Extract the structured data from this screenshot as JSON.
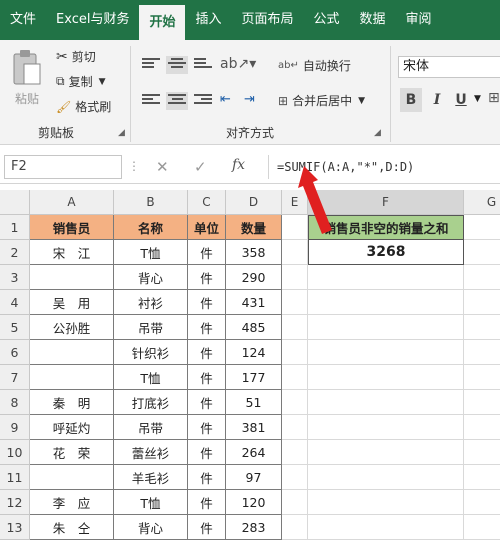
{
  "tabs": [
    "文件",
    "Excel与财务",
    "开始",
    "插入",
    "页面布局",
    "公式",
    "数据",
    "审阅"
  ],
  "ribbon": {
    "paste": "粘贴",
    "cut": "剪切",
    "copy": "复制",
    "format_painter": "格式刷",
    "clipboard_group": "剪贴板",
    "wrap_text": "自动换行",
    "merge_center": "合并后居中",
    "alignment_group": "对齐方式",
    "font_name": "宋体",
    "bold": "B",
    "italic": "I",
    "underline": "U"
  },
  "formula_bar": {
    "name_box": "F2",
    "formula": "=SUMIF(A:A,\"*\",D:D)",
    "cancel": "✕",
    "enter": "✓",
    "fx": "fx"
  },
  "columns": [
    "A",
    "B",
    "C",
    "D",
    "E",
    "F",
    "G"
  ],
  "row_numbers": [
    "1",
    "2",
    "3",
    "4",
    "5",
    "6",
    "7",
    "8",
    "9",
    "10",
    "11",
    "12",
    "13"
  ],
  "table": {
    "headers": [
      "销售员",
      "名称",
      "单位",
      "数量"
    ],
    "rows": [
      [
        "宋　江",
        "T恤",
        "件",
        "358"
      ],
      [
        "",
        "背心",
        "件",
        "290"
      ],
      [
        "吴　用",
        "衬衫",
        "件",
        "431"
      ],
      [
        "公孙胜",
        "吊带",
        "件",
        "485"
      ],
      [
        "",
        "针织衫",
        "件",
        "124"
      ],
      [
        "",
        "T恤",
        "件",
        "177"
      ],
      [
        "秦　明",
        "打底衫",
        "件",
        "51"
      ],
      [
        "呼延灼",
        "吊带",
        "件",
        "381"
      ],
      [
        "花　荣",
        "蕾丝衫",
        "件",
        "264"
      ],
      [
        "",
        "羊毛衫",
        "件",
        "97"
      ],
      [
        "李　应",
        "T恤",
        "件",
        "120"
      ],
      [
        "朱　仝",
        "背心",
        "件",
        "283"
      ]
    ]
  },
  "summary": {
    "label": "销售员非空的销量之和",
    "value": "3268"
  },
  "colors": {
    "accent": "#217346",
    "header_fill": "#f4b183",
    "summary_fill": "#a9d08e",
    "arrow": "#e02020"
  }
}
